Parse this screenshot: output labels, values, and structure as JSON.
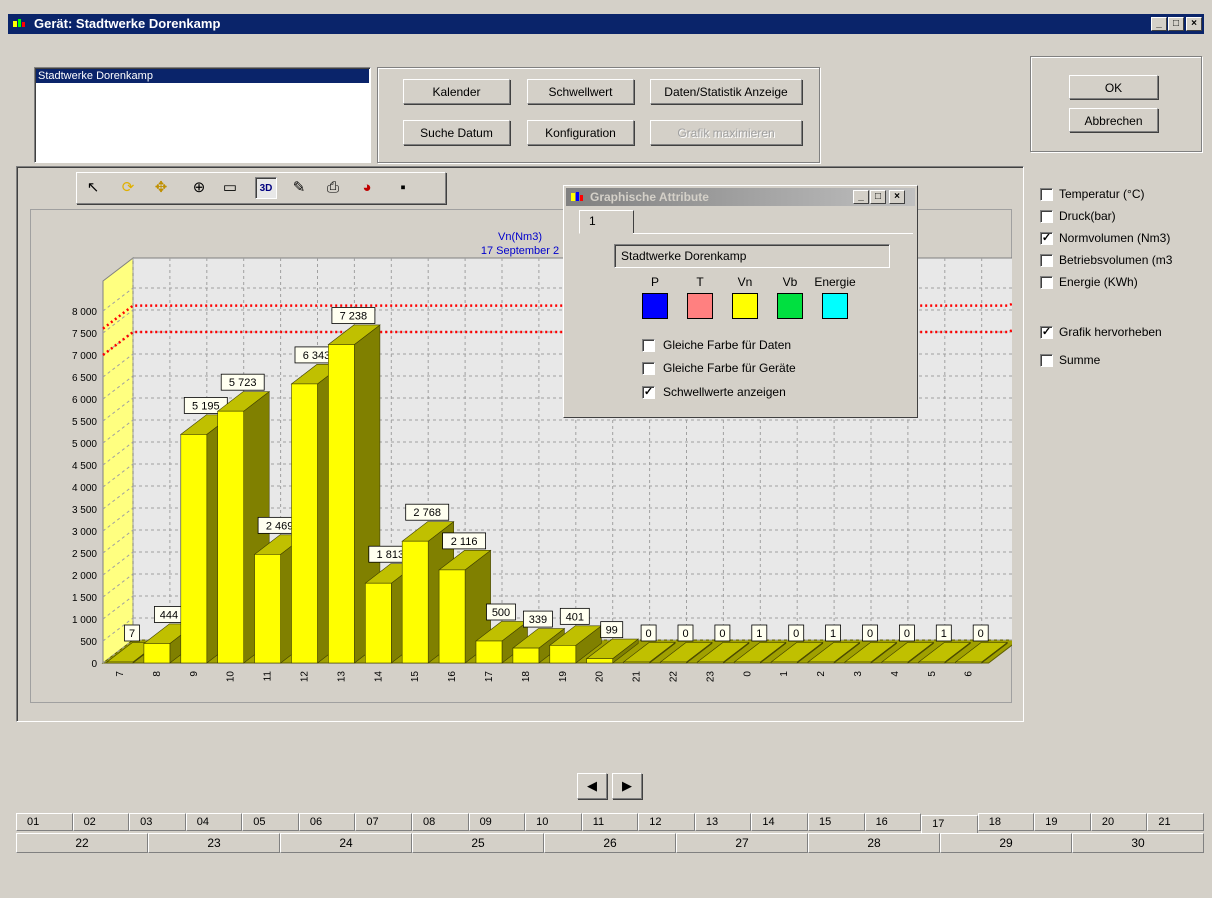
{
  "window": {
    "title": "Gerät: Stadtwerke Dorenkamp",
    "minimize": "_",
    "maximize": "□",
    "close": "×"
  },
  "device_list": {
    "selected": "Stadtwerke Dorenkamp"
  },
  "buttons": {
    "kalender": "Kalender",
    "schwellwert": "Schwellwert",
    "daten_statistik": "Daten/Statistik Anzeige",
    "suche_datum": "Suche Datum",
    "konfiguration": "Konfiguration",
    "grafik_maximieren": "Grafik maximieren",
    "ok": "OK",
    "abbrechen": "Abbrechen"
  },
  "toolbar": {
    "icons": [
      "pointer-arrow-icon",
      "rotate-icon",
      "move-icon",
      "zoom-icon",
      "page-setup-icon",
      "3d-toggle-icon",
      "edit-chart-icon",
      "print-icon",
      "palette-icon",
      "save-icon"
    ],
    "label_3d": "3D"
  },
  "options": {
    "temperatur": {
      "label": "Temperatur (°C)",
      "checked": false
    },
    "druck": {
      "label": "Druck(bar)",
      "checked": false
    },
    "normvolumen": {
      "label": "Normvolumen (Nm3)",
      "checked": true
    },
    "betriebsvolumen": {
      "label": "Betriebsvolumen (m3",
      "checked": false
    },
    "energie": {
      "label": "Energie (KWh)",
      "checked": false
    },
    "grafik_hervorheben": {
      "label": "Grafik hervorheben",
      "checked": true
    },
    "summe": {
      "label": "Summe",
      "checked": false
    }
  },
  "chart_data": {
    "type": "bar",
    "title": "Vn(Nm3)",
    "subtitle": "17 September 2",
    "categories": [
      "7",
      "8",
      "9",
      "10",
      "11",
      "12",
      "13",
      "14",
      "15",
      "16",
      "17",
      "18",
      "19",
      "20",
      "21",
      "22",
      "23",
      "0",
      "1",
      "2",
      "3",
      "4",
      "5",
      "6"
    ],
    "values": [
      7,
      444,
      5195,
      5723,
      2469,
      6343,
      7238,
      1813,
      2768,
      2116,
      500,
      339,
      401,
      99,
      0,
      0,
      0,
      1,
      0,
      1,
      0,
      0,
      1,
      0
    ],
    "value_labels": [
      "7",
      "444",
      "5 195",
      "5 723",
      "2 469",
      "6 343",
      "7 238",
      "1 813",
      "2 768",
      "2 116",
      "500",
      "339",
      "401",
      "99",
      "0",
      "0",
      "0",
      "1",
      "0",
      "1",
      "0",
      "0",
      "1",
      "0"
    ],
    "yticks": [
      "0",
      "500",
      "1 000",
      "1 500",
      "2 000",
      "2 500",
      "3 000",
      "3 500",
      "4 000",
      "4 500",
      "5 000",
      "5 500",
      "6 000",
      "6 500",
      "7 000",
      "7 500",
      "8 000"
    ],
    "ylim": [
      0,
      8000
    ],
    "thresholds": [
      7000,
      7600
    ],
    "bar_color": "#ffff00",
    "threshold_color": "#ff0000",
    "grid": true
  },
  "dialog": {
    "title": "Graphische Attribute",
    "tab": "1",
    "device": "Stadtwerke Dorenkamp",
    "colors": [
      {
        "label": "P",
        "color": "#0000ff"
      },
      {
        "label": "T",
        "color": "#ff8080"
      },
      {
        "label": "Vn",
        "color": "#ffff00"
      },
      {
        "label": "Vb",
        "color": "#00e040"
      },
      {
        "label": "Energie",
        "color": "#00ffff"
      }
    ],
    "gleiche_farbe_daten": {
      "label": "Gleiche Farbe für Daten",
      "checked": false
    },
    "gleiche_farbe_geraete": {
      "label": "Gleiche Farbe für Geräte",
      "checked": false
    },
    "schwellwerte_anzeigen": {
      "label": "Schwellwerte anzeigen",
      "checked": true
    }
  },
  "nav": {
    "prev": "◀",
    "next": "▶"
  },
  "day_tabs": {
    "row1": [
      "01",
      "02",
      "03",
      "04",
      "05",
      "06",
      "07",
      "08",
      "09",
      "10",
      "11",
      "12",
      "13",
      "14",
      "15",
      "16",
      "17",
      "18",
      "19",
      "20",
      "21"
    ],
    "row2": [
      "22",
      "23",
      "24",
      "25",
      "26",
      "27",
      "28",
      "29",
      "30"
    ],
    "selected": "17"
  }
}
